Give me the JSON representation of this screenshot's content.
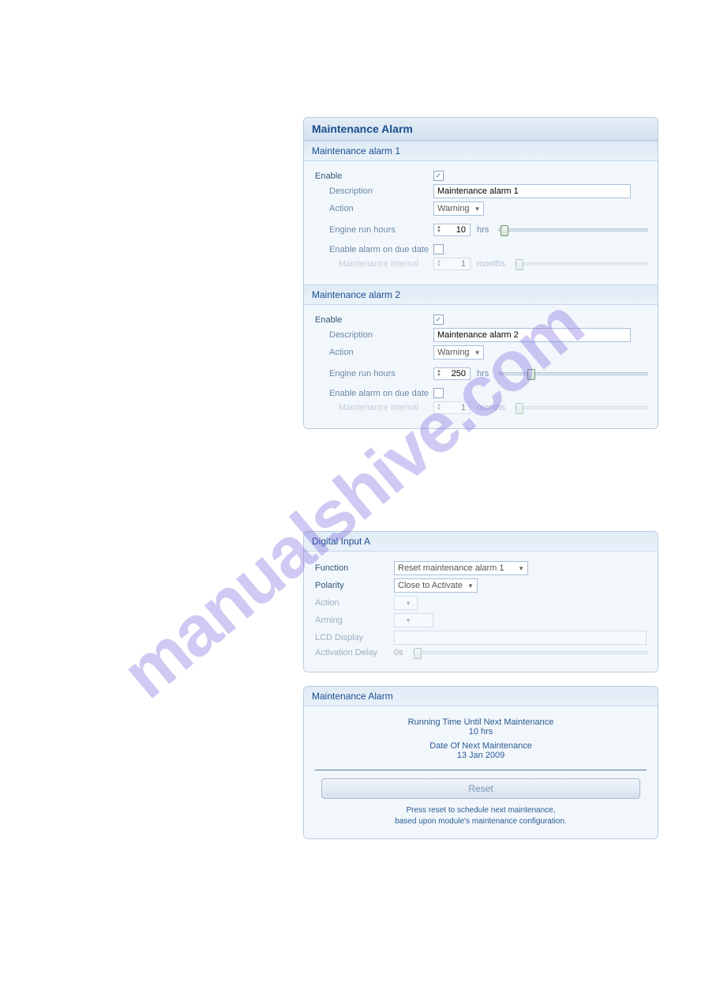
{
  "watermark": "manualshive.com",
  "maintenance": {
    "title": "Maintenance Alarm",
    "alarm1": {
      "header": "Maintenance alarm 1",
      "enable_label": "Enable",
      "enable_checked": true,
      "description_label": "Description",
      "description_value": "Maintenance alarm 1",
      "action_label": "Action",
      "action_value": "Warning",
      "run_hours_label": "Engine run hours",
      "run_hours_value": "10",
      "run_hours_unit": "hrs",
      "due_date_label": "Enable alarm on due date",
      "due_date_checked": false,
      "interval_label": "Maintenance interval",
      "interval_value": "1",
      "interval_unit": "months"
    },
    "alarm2": {
      "header": "Maintenance alarm 2",
      "enable_label": "Enable",
      "enable_checked": true,
      "description_label": "Description",
      "description_value": "Maintenance alarm 2",
      "action_label": "Action",
      "action_value": "Warning",
      "run_hours_label": "Engine run hours",
      "run_hours_value": "250",
      "run_hours_unit": "hrs",
      "due_date_label": "Enable alarm on due date",
      "due_date_checked": false,
      "interval_label": "Maintenance interval",
      "interval_value": "1",
      "interval_unit": "months"
    }
  },
  "digital_input": {
    "title": "Digital Input A",
    "function_label": "Function",
    "function_value": "Reset maintenance alarm 1",
    "polarity_label": "Polarity",
    "polarity_value": "Close to Activate",
    "action_label": "Action",
    "arming_label": "Arming",
    "lcd_label": "LCD Display",
    "delay_label": "Activation Delay",
    "delay_value": "0s"
  },
  "scada": {
    "title": "Maintenance Alarm",
    "running_label": "Running Time Until Next Maintenance",
    "running_value": "10 hrs",
    "date_label": "Date Of Next Maintenance",
    "date_value": "13 Jan 2009",
    "reset_label": "Reset",
    "note_line1": "Press reset to schedule next maintenance,",
    "note_line2": "based upon module's maintenance configuration."
  }
}
